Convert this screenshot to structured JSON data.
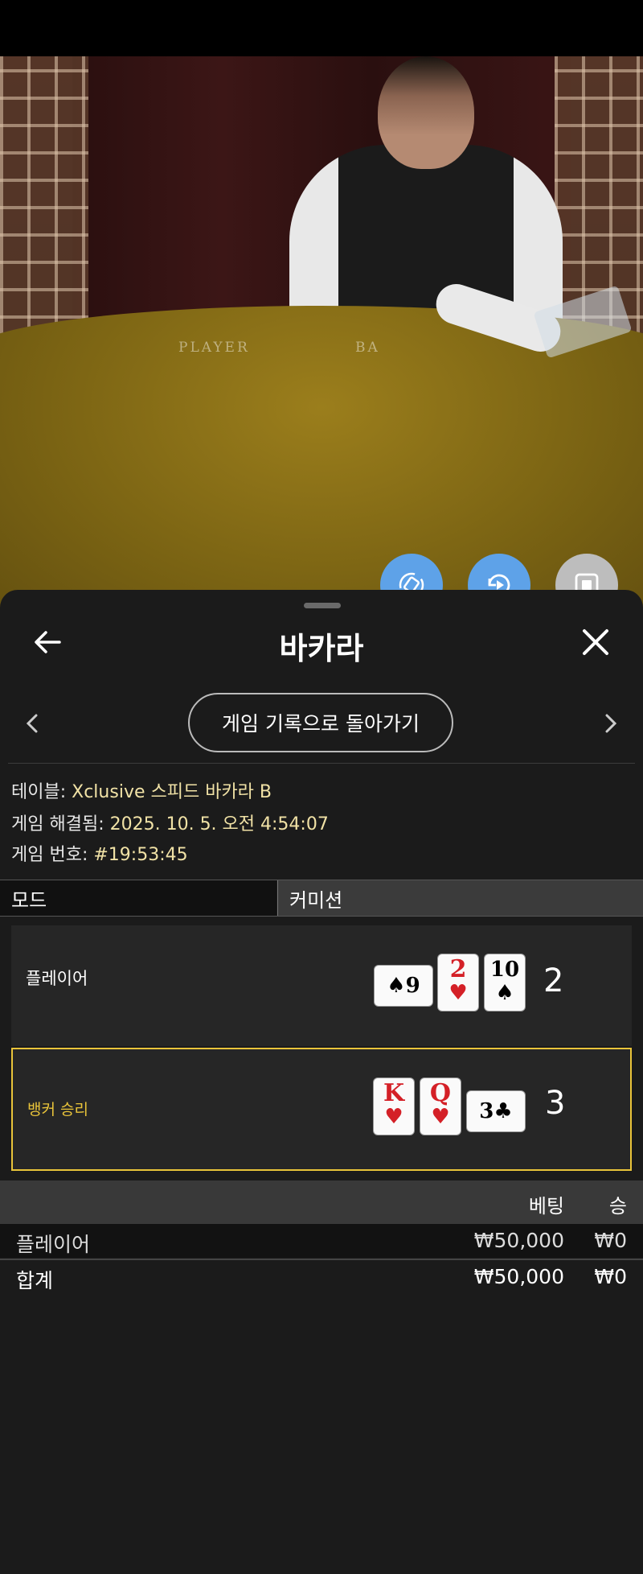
{
  "title": "바카라",
  "nav": {
    "back_to_history": "게임 기록으로 돌아가기"
  },
  "felt_labels": {
    "player": "PLAYER",
    "banker": "BA"
  },
  "info": {
    "table_label": "테이블:",
    "table_value": "Xclusive 스피드 바카라 B",
    "resolved_label": "게임 해결됨:",
    "resolved_value": "2025. 10. 5. 오전 4:54:07",
    "game_no_label": "게임 번호:",
    "game_no_value": "#19:53:45"
  },
  "tabs": {
    "mode": "모드",
    "commission": "커미션"
  },
  "hands": {
    "player": {
      "label": "플레이어",
      "score": "2",
      "cards": [
        {
          "rank": "9",
          "suit": "♠",
          "side": true
        },
        {
          "rank": "2",
          "suit": "♥"
        },
        {
          "rank": "10",
          "suit": "♠"
        }
      ]
    },
    "banker": {
      "label": "뱅커 승리",
      "score": "3",
      "cards": [
        {
          "rank": "K",
          "suit": "♥"
        },
        {
          "rank": "Q",
          "suit": "♥"
        },
        {
          "rank": "3",
          "suit": "♣",
          "side": true
        }
      ]
    }
  },
  "bets": {
    "columns": {
      "bet": "베팅",
      "win": "승"
    },
    "rows": [
      {
        "name": "플레이어",
        "bet": "₩50,000",
        "win": "₩0"
      }
    ],
    "total": {
      "name": "합계",
      "bet": "₩50,000",
      "win": "₩0"
    }
  },
  "colors": {
    "accent_blue": "#5ea2e8",
    "winner_gold": "#e9c43a",
    "panel_bg": "#1b1b1b"
  }
}
